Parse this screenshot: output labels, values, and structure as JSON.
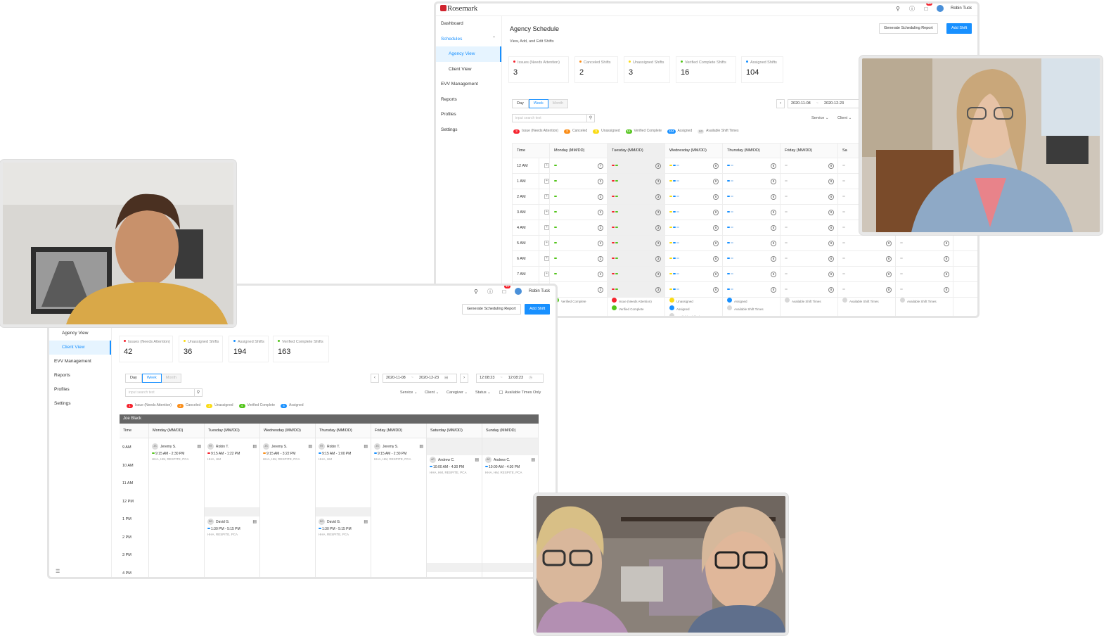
{
  "app": {
    "brand": "Rosemark",
    "user": "Robin Tuck",
    "notif_count": "11",
    "colors": {
      "primary": "#1890ff",
      "issue": "#f5222d",
      "canceled": "#fa8c16",
      "unassigned": "#fadb14",
      "verified": "#52c41a",
      "assigned": "#1890ff"
    }
  },
  "agency_window": {
    "sidebar": {
      "dashboard": "Dashboard",
      "schedules": "Schedules",
      "agency_view": "Agency View",
      "client_view": "Client View",
      "evv": "EVV Management",
      "reports": "Reports",
      "profiles": "Profiles",
      "settings": "Settings"
    },
    "title": "Agency Schedule",
    "subtitle": "View, Add, and Edit Shifts",
    "generate_btn": "Generate Scheduling Report",
    "add_btn": "Add Shift",
    "stats": [
      {
        "label": "Issues (Needs Attention)",
        "value": "3"
      },
      {
        "label": "Canceled Shifts",
        "value": "2"
      },
      {
        "label": "Unassigned Shifts",
        "value": "3"
      },
      {
        "label": "Verified Complete Shifts",
        "value": "16"
      },
      {
        "label": "Assigned Shifts",
        "value": "104"
      }
    ],
    "views": {
      "day": "Day",
      "week": "Week",
      "month": "Month"
    },
    "date_from": "2020-11-08",
    "date_to": "2020-12-23",
    "search_placeholder": "input search text",
    "service": "Service",
    "client": "Client",
    "legend": [
      {
        "count": "3",
        "label": "Issue (Needs Attention)"
      },
      {
        "count": "2",
        "label": "Canceled"
      },
      {
        "count": "3",
        "label": "Unassigned"
      },
      {
        "count": "16",
        "label": "Verified Complete"
      },
      {
        "count": "104",
        "label": "Assigned"
      },
      {
        "count": "63",
        "label": "Available Shift Times"
      }
    ],
    "columns": [
      "Time",
      "Monday (MM/DD)",
      "Tuesday (MM/DD)",
      "Wednesday (MM/DD)",
      "Thursday (MM/DD)",
      "Friday (MM/DD)",
      "Sa"
    ],
    "rows": [
      "12 AM",
      "1 AM",
      "2 AM",
      "3 AM",
      "4 AM",
      "5 AM",
      "6 AM",
      "7 AM",
      ""
    ],
    "counts": {
      "monday": "2",
      "tuesday": "3",
      "wednesday": "8",
      "thursday": "8",
      "friday": "8",
      "saturday": "8",
      "sunday": "8"
    },
    "day_counts_first_row": {
      "monday": "?"
    },
    "footer": {
      "monday": [
        "Verified Complete"
      ],
      "tuesday": [
        "Issue (Needs Attention)",
        "Verified Complete"
      ],
      "wednesday": [
        "Unassigned",
        "Assigned",
        "Available Shift Times"
      ],
      "thursday": [
        "Assigned",
        "Available Shift Times"
      ],
      "friday": [
        "Available Shift Times"
      ],
      "saturday": [
        "Available Shift Times"
      ],
      "sunday": [
        "Available Shift Times"
      ]
    }
  },
  "client_window": {
    "user": "Robin Tuck",
    "notif_count": "11",
    "generate_btn": "Generate Scheduling Report",
    "add_btn": "Add Shift",
    "sidebar": {
      "agency_view": "Agency View",
      "client_view": "Client View",
      "evv": "EVV Management",
      "reports": "Reports",
      "profiles": "Profiles",
      "settings": "Settings"
    },
    "stats": [
      {
        "label": "Issues (Needs Attention)",
        "value": "42"
      },
      {
        "label": "Unassigned Shifts",
        "value": "36"
      },
      {
        "label": "Assigned Shifts",
        "value": "194"
      },
      {
        "label": "Verified Complete Shifts",
        "value": "163"
      }
    ],
    "views": {
      "day": "Day",
      "week": "Week",
      "month": "Month"
    },
    "date_from": "2020-11-08",
    "date_to": "2020-12-23",
    "time_from": "12:08:23",
    "time_to": "12:08:23",
    "search_placeholder": "input search text",
    "filters": {
      "service": "Service",
      "client": "Client",
      "caregiver": "Caregiver",
      "status": "Status",
      "available": "Available Times Only"
    },
    "legend": [
      {
        "count": "1",
        "label": "Issue (Needs Attention)"
      },
      {
        "count": "2",
        "label": "Canceled"
      },
      {
        "count": "3",
        "label": "Unassigned"
      },
      {
        "count": "4",
        "label": "Verified Complete"
      },
      {
        "count": "5",
        "label": "Assigned"
      }
    ],
    "client_name": "Joe Black",
    "columns": [
      "Time",
      "Monday (MM/DD)",
      "Tuesday (MM/DD)",
      "Wednesday (MM/DD)",
      "Thursday (MM/DD)",
      "Friday (MM/DD)",
      "Saturday (MM/DD)",
      "Sunday (MM/DD)"
    ],
    "times": [
      "9 AM",
      "10 AM",
      "11 AM",
      "12 PM",
      "1 PM",
      "2 PM",
      "3 PM",
      "4 PM"
    ],
    "shifts": [
      {
        "initials": "JS",
        "name": "Jeremy S.",
        "time": "9:15 AM - 2:30 PM",
        "services": "HHA, HM, RESPITE, PCA"
      },
      {
        "initials": "RT",
        "name": "Robin T.",
        "time": "9:15 AM - 1:22 PM",
        "services": "HHA, HM"
      },
      {
        "initials": "JS",
        "name": "Jeremy S.",
        "time": "9:15 AM - 3:22 PM",
        "services": "HHA, HM, RESPITE, PCA"
      },
      {
        "initials": "RT",
        "name": "Robin T.",
        "time": "9:15 AM - 1:00 PM",
        "services": "HHA, HM"
      },
      {
        "initials": "JS",
        "name": "Jeremy S.",
        "time": "9:15 AM - 2:30 PM",
        "services": "HHA, HM, RESPITE, PCA"
      },
      {
        "initials": "AC",
        "name": "Andrew C.",
        "time": "10:00 AM - 4:30 PM",
        "services": "HHA, HM, RESPITE, PCA"
      },
      {
        "initials": "AC",
        "name": "Andrew C.",
        "time": "10:00 AM - 4:30 PM",
        "services": "HHA, HM, RESPITE, PCA"
      },
      {
        "initials": "DG",
        "name": "David G.",
        "time": "1:30 PM - 5:15 PM",
        "services": "HHA, RESPITE, PCA"
      },
      {
        "initials": "DG",
        "name": "David G.",
        "time": "1:30 PM - 5:15 PM",
        "services": "HHA, RESPITE, PCA"
      }
    ]
  },
  "videos": [
    {
      "id": "participant-1",
      "icon": "video-feed-man"
    },
    {
      "id": "participant-2",
      "icon": "video-feed-woman"
    },
    {
      "id": "participant-3",
      "icon": "video-feed-two-women"
    }
  ]
}
